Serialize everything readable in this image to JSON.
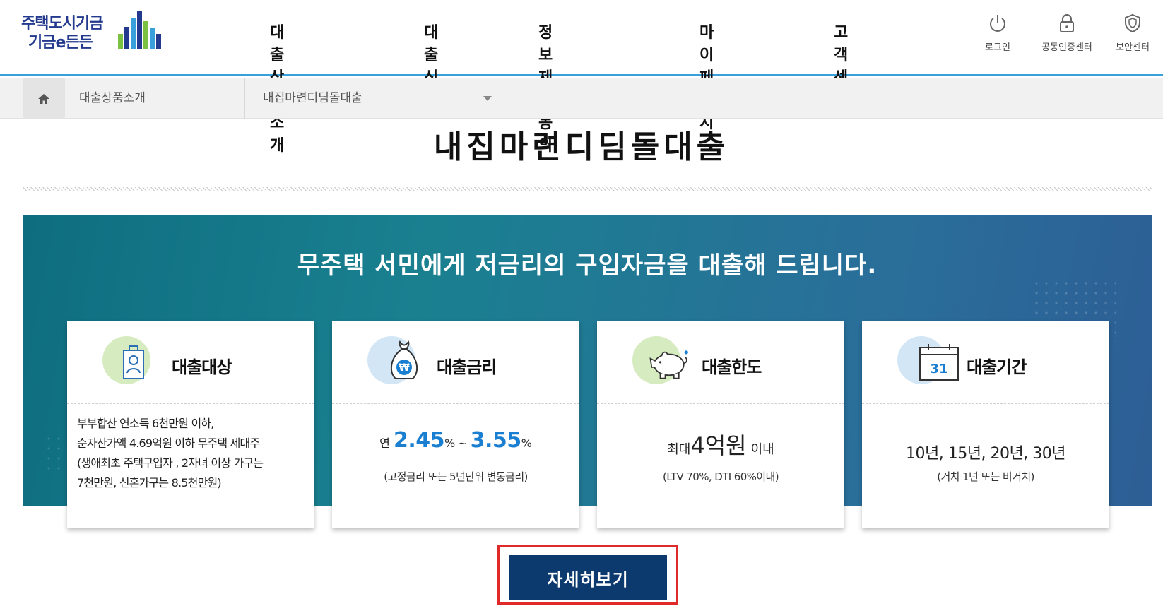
{
  "header": {
    "logo": {
      "line1": "주택도시기금",
      "line2": "기금e든든"
    },
    "nav": [
      "대출상품소개",
      "대출신청",
      "정보제공동의",
      "마이페이지",
      "고객센터"
    ],
    "util": [
      {
        "label": "로그인",
        "icon": "power-icon"
      },
      {
        "label": "공동인증센터",
        "icon": "lock-icon"
      },
      {
        "label": "보안센터",
        "icon": "shield-icon"
      }
    ],
    "accent_color": "#3aa0dc"
  },
  "breadcrumb": {
    "home_icon": "home-icon",
    "level1": "대출상품소개",
    "level2": "내집마련디딤돌대출"
  },
  "page": {
    "title": "내집마련디딤돌대출"
  },
  "banner": {
    "headline": "무주택 서민에게 저금리의 구입자금을 대출해 드립니다."
  },
  "cards": [
    {
      "title": "대출대상",
      "icon": "id-badge-icon",
      "lines": [
        "부부합산 연소득 6천만원 이하,",
        "순자산가액 4.69억원 이하 무주택 세대주",
        "(생애최초 주택구입자 , 2자녀 이상 가구는",
        "7천만원, 신혼가구는 8.5천만원)"
      ]
    },
    {
      "title": "대출금리",
      "icon": "money-bag-icon",
      "prefix": "연",
      "rate_min": "2.45",
      "rate_max": "3.55",
      "unit": "%",
      "tilde": "~",
      "note": "(고정금리 또는 5년단위 변동금리)"
    },
    {
      "title": "대출한도",
      "icon": "piggy-bank-icon",
      "prefix": "최대",
      "amount": "4억원",
      "suffix": "이내",
      "note": "(LTV 70%, DTI 60%이내)"
    },
    {
      "title": "대출기간",
      "icon": "calendar-icon",
      "calendar_day": "31",
      "periods": "10년, 15년, 20년, 30년",
      "note": "(거치 1년 또는 비거치)"
    }
  ],
  "detail_button": {
    "label": "자세히보기",
    "color": "#0c3a6e"
  }
}
